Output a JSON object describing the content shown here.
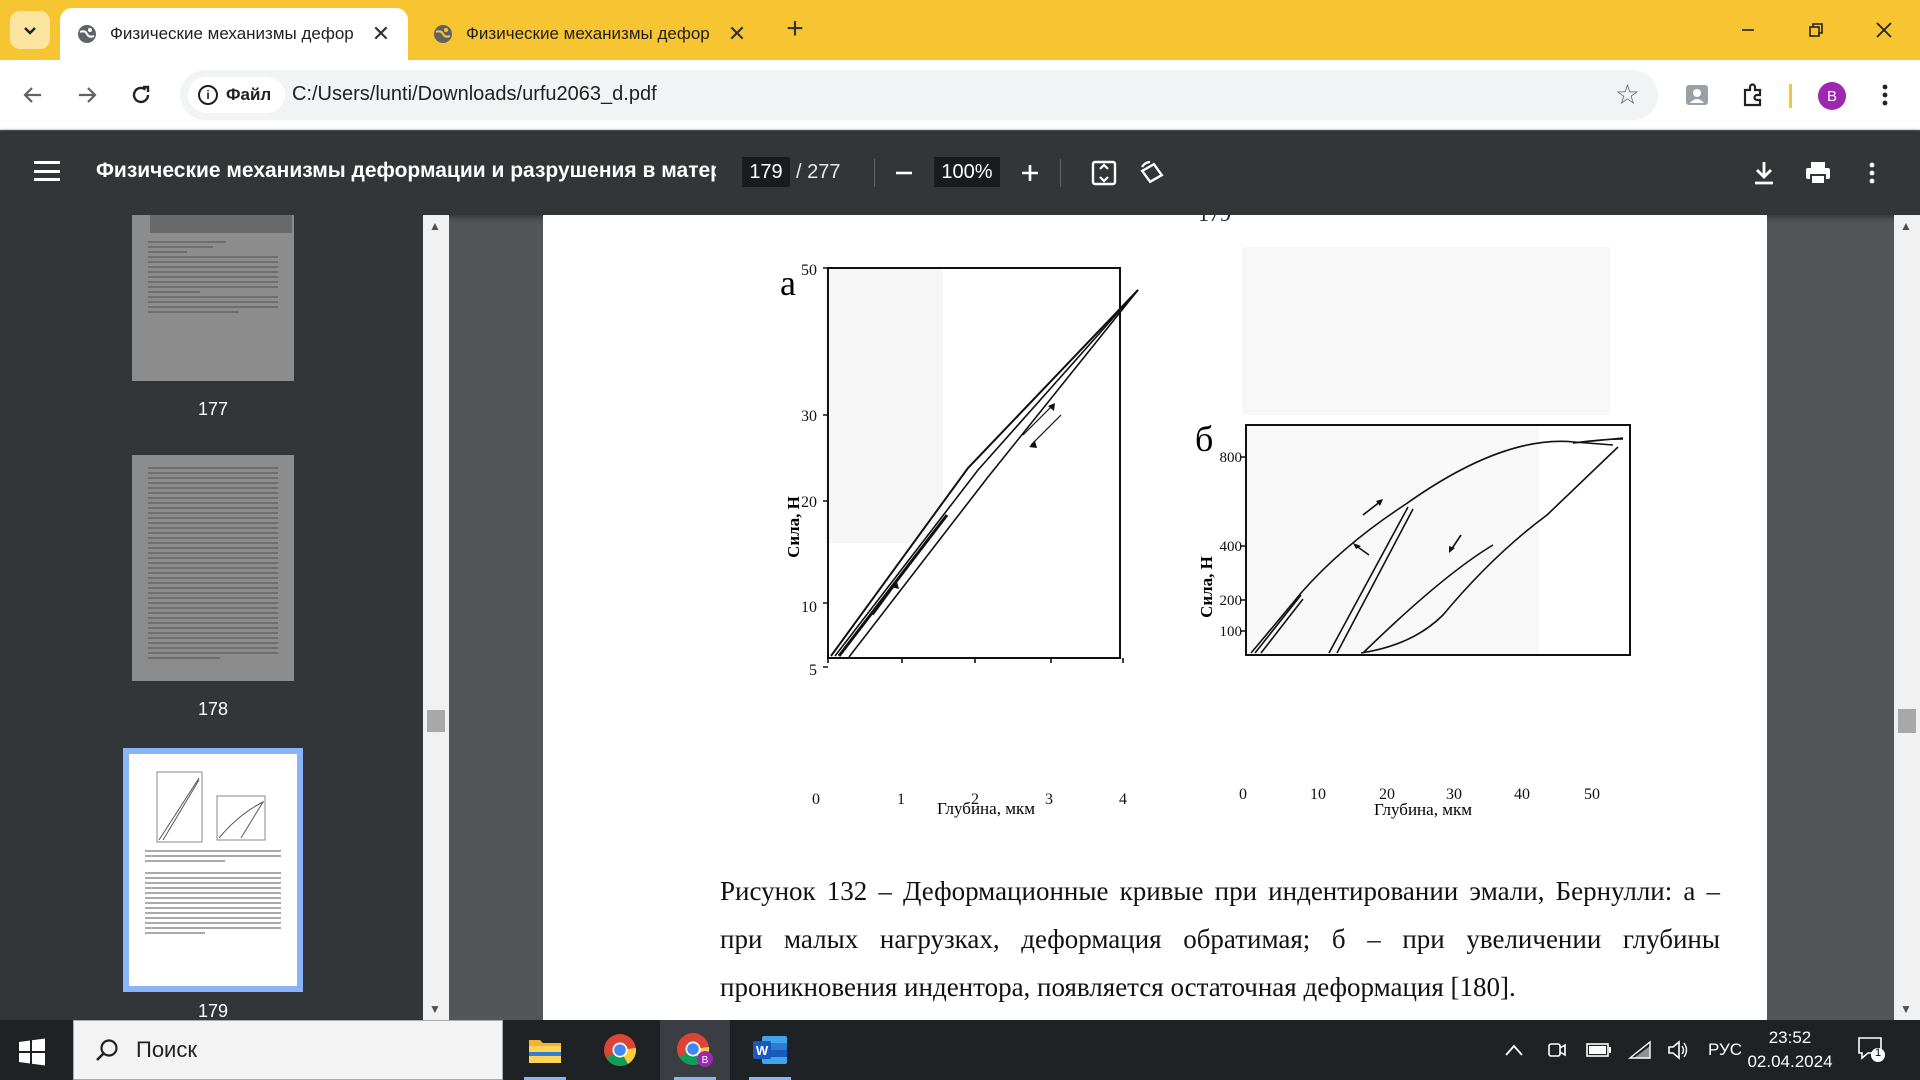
{
  "browser": {
    "tabs": [
      {
        "title": "Физические механизмы дефор",
        "active": true
      },
      {
        "title": "Физические механизмы дефор",
        "active": false
      }
    ],
    "address": {
      "chip_label": "Файл",
      "url": "C:/Users/lunti/Downloads/urfu2063_d.pdf"
    },
    "profile_initial": "B"
  },
  "pdf": {
    "title": "Физические механизмы деформации и разрушения в матер...",
    "current_page": "179",
    "total_pages": "/ 277",
    "zoom": "100%",
    "page_number_fragment": "179"
  },
  "sidebar": {
    "thumbnails": [
      {
        "label": "177"
      },
      {
        "label": "178"
      },
      {
        "label": "179",
        "selected": true
      }
    ]
  },
  "figure": {
    "panel_a": {
      "letter": "а",
      "ylabel": "Сила, Н",
      "xlabel": "Глубина, мкм",
      "yticks": [
        "5",
        "10",
        "20",
        "30",
        "50"
      ],
      "xticks": [
        "0",
        "1",
        "2",
        "3",
        "4"
      ]
    },
    "panel_b": {
      "letter": "б",
      "ylabel": "Сила, Н",
      "xlabel": "Глубина, мкм",
      "yticks": [
        "100",
        "200",
        "400",
        "800"
      ],
      "xticks": [
        "0",
        "10",
        "20",
        "30",
        "40",
        "50"
      ]
    },
    "caption": "Рисунок 132 – Деформационные кривые при индентировании эмали, Бернулли: а – при малых нагрузках, деформация обратимая; б – при увеличении глубины проникновения индентора, появляется остаточная деформация [180]."
  },
  "taskbar": {
    "search_placeholder": "Поиск",
    "language": "РУС",
    "time": "23:52",
    "date": "02.04.2024",
    "notification_count": "1"
  }
}
